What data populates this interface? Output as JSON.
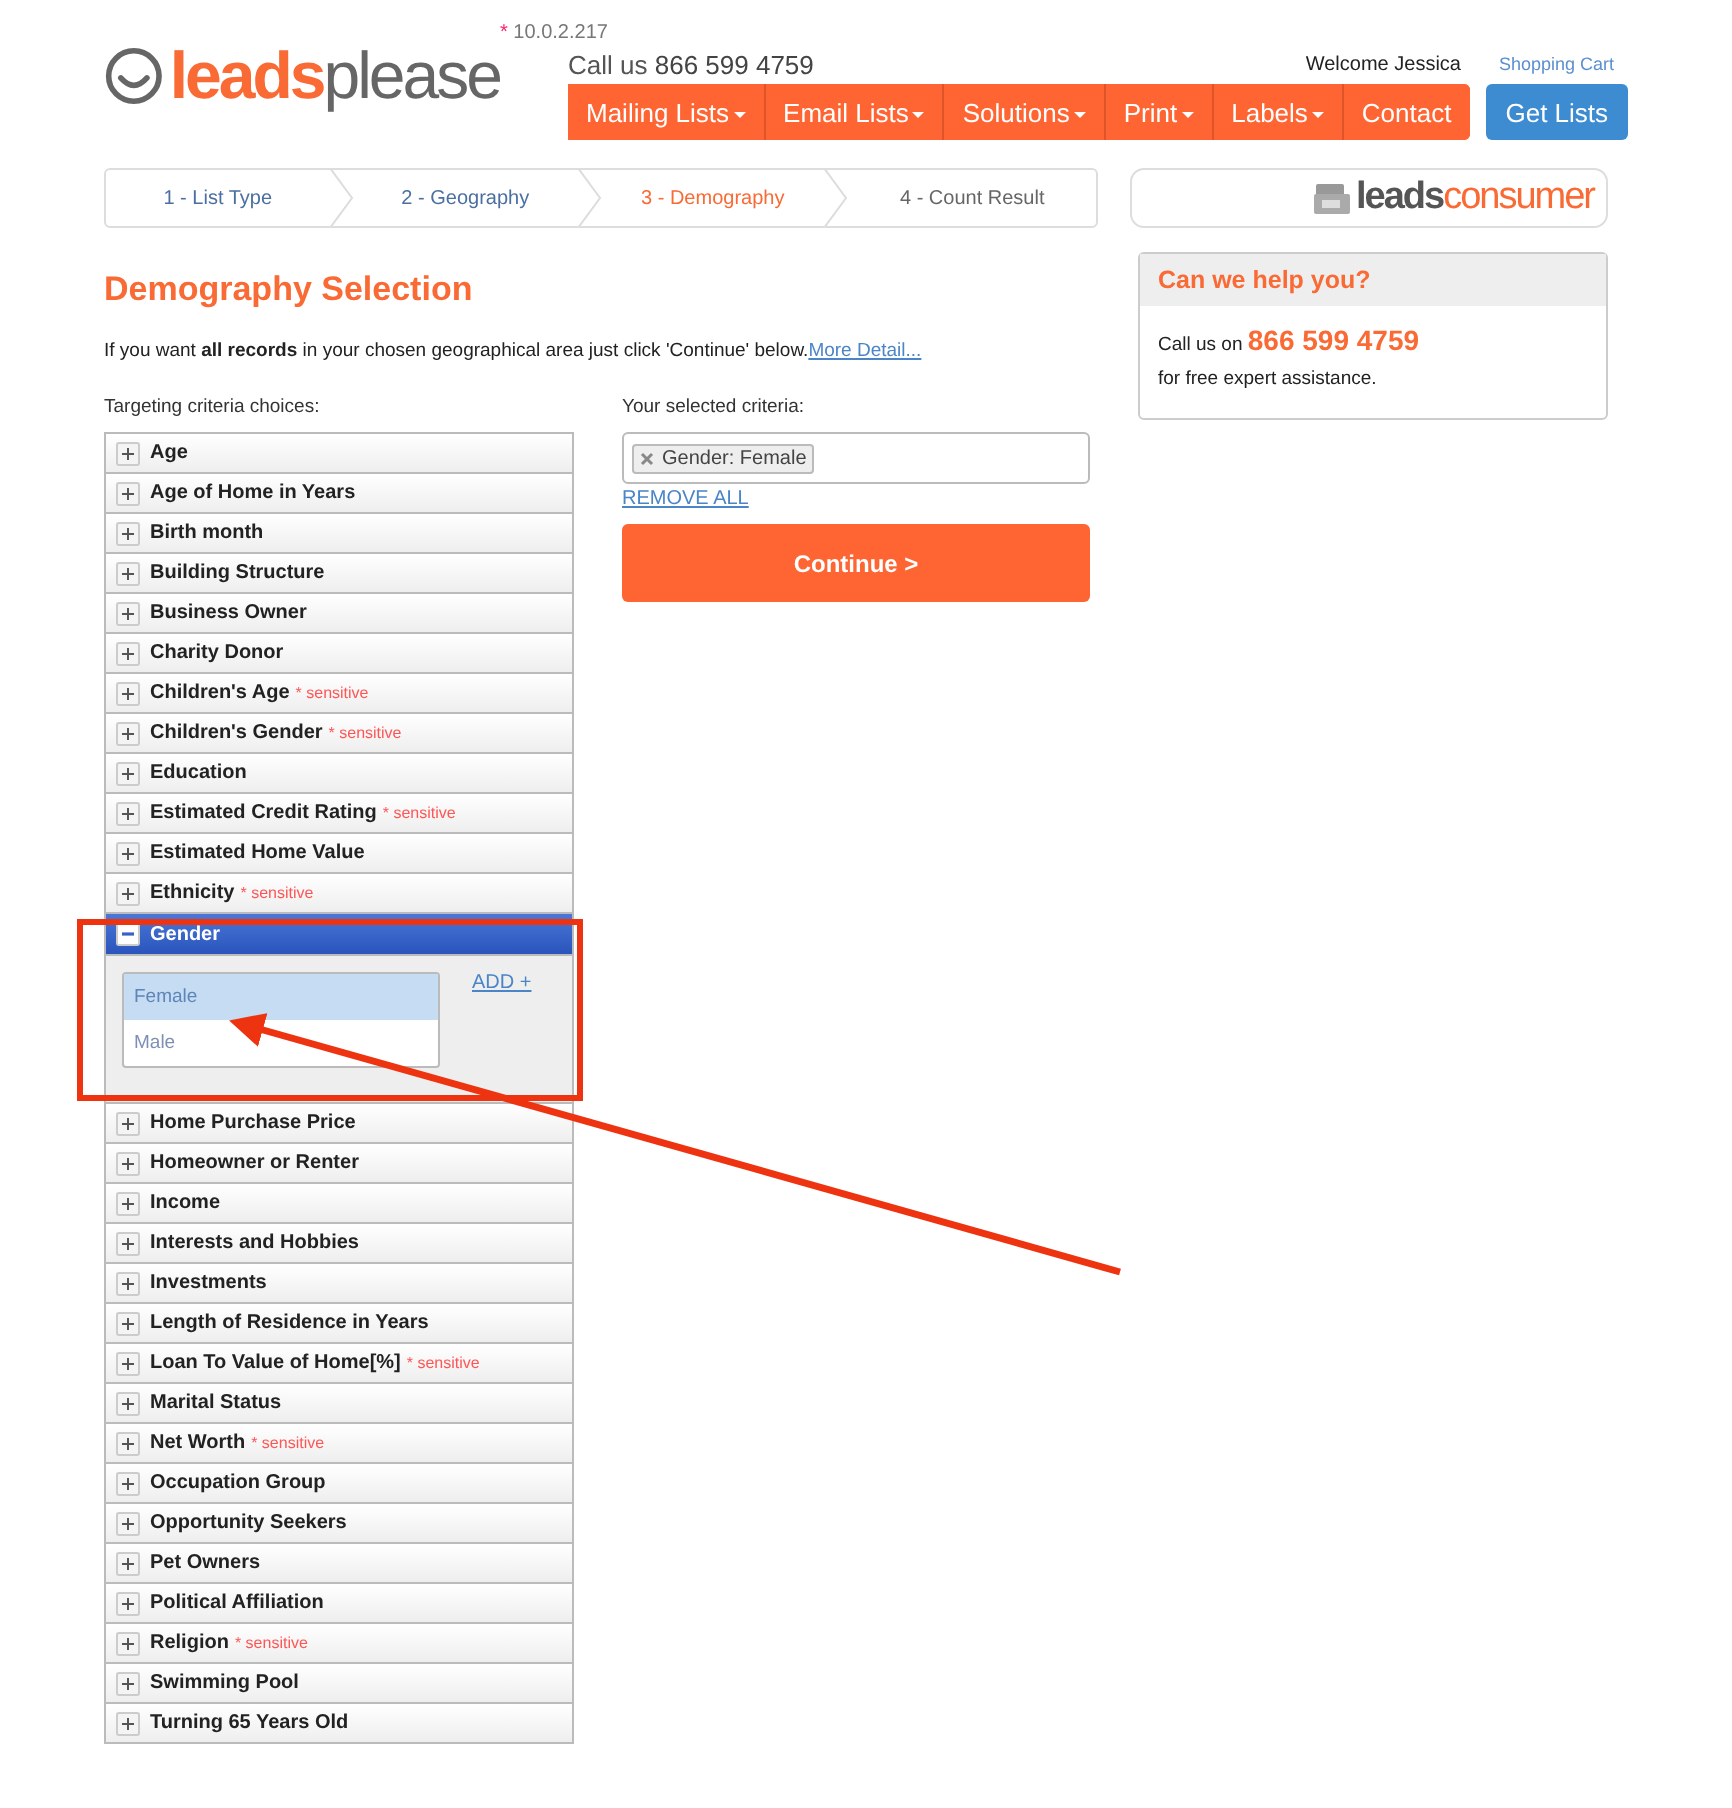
{
  "header": {
    "logo": [
      "leads",
      "please"
    ],
    "ip_note": {
      "mark": "*",
      "text": "10.0.2.217"
    },
    "phone_line": {
      "label": "Call us",
      "number": "866 599 4759"
    },
    "welcome": "Welcome Jessica",
    "cart_link": "Shopping Cart"
  },
  "nav": [
    {
      "label": "Mailing Lists",
      "dropdown": true
    },
    {
      "label": "Email Lists",
      "dropdown": true
    },
    {
      "label": "Solutions",
      "dropdown": true
    },
    {
      "label": "Print",
      "dropdown": true
    },
    {
      "label": "Labels",
      "dropdown": true
    },
    {
      "label": "Contact",
      "dropdown": false
    }
  ],
  "get_lists_button": "Get Lists",
  "steps": [
    {
      "label": "1 - List Type",
      "selected": false
    },
    {
      "label": "2 - Geography",
      "selected": false
    },
    {
      "label": "3 - Demography",
      "selected": true
    },
    {
      "label": "4 - Count Result",
      "selected": false
    }
  ],
  "partner_logo": [
    "leads",
    "consumer"
  ],
  "page_title": "Demography Selection",
  "intro": "If you want **all records** in your chosen geographical area just click 'Continue' below.",
  "intro_link": "More Detail...",
  "choices_label": "Targeting criteria choices:",
  "criteria": [
    {
      "label": "Age",
      "expanded": false
    },
    {
      "label": "Age of Home in Years",
      "expanded": false
    },
    {
      "label": "Birth month",
      "expanded": false
    },
    {
      "label": "Building Structure",
      "expanded": false
    },
    {
      "label": "Business Owner",
      "expanded": false
    },
    {
      "label": "Charity Donor",
      "expanded": false
    },
    {
      "label": "Children's Age",
      "note": "* sensitive",
      "expanded": false
    },
    {
      "label": "Children's Gender",
      "note": "* sensitive",
      "expanded": false
    },
    {
      "label": "Education",
      "expanded": false
    },
    {
      "label": "Estimated Credit Rating",
      "note": "* sensitive",
      "expanded": false
    },
    {
      "label": "Estimated Home Value",
      "expanded": false
    },
    {
      "label": "Ethnicity",
      "note": "* sensitive",
      "expanded": false
    },
    {
      "label": "Gender",
      "expanded": true,
      "options": [
        {
          "label": "Female",
          "selected": true
        },
        {
          "label": "Male",
          "selected": false
        }
      ],
      "add_link": "ADD +"
    },
    {
      "label": "Home Purchase Price",
      "expanded": false
    },
    {
      "label": "Homeowner or Renter",
      "expanded": false
    },
    {
      "label": "Income",
      "expanded": false
    },
    {
      "label": "Interests and Hobbies",
      "expanded": false
    },
    {
      "label": "Investments",
      "expanded": false
    },
    {
      "label": "Length of Residence in Years",
      "expanded": false
    },
    {
      "label": "Loan To Value of Home[%]",
      "note": "* sensitive",
      "expanded": false
    },
    {
      "label": "Marital Status",
      "expanded": false
    },
    {
      "label": "Net Worth",
      "note": "* sensitive",
      "expanded": false
    },
    {
      "label": "Occupation Group",
      "expanded": false
    },
    {
      "label": "Opportunity Seekers",
      "expanded": false
    },
    {
      "label": "Pet Owners",
      "expanded": false
    },
    {
      "label": "Political Affiliation",
      "expanded": false
    },
    {
      "label": "Religion",
      "note": "* sensitive",
      "expanded": false
    },
    {
      "label": "Swimming Pool",
      "expanded": false
    },
    {
      "label": "Turning 65 Years Old",
      "expanded": false
    }
  ],
  "selected_label": "Your selected criteria:",
  "selected_tags": [
    "Gender: Female"
  ],
  "remove_all": "REMOVE ALL",
  "continue_button": "Continue >",
  "help": {
    "title": "Can we help you?",
    "call_label": "Call us on",
    "phone": "866 599 4759",
    "note": "for free expert assistance."
  }
}
